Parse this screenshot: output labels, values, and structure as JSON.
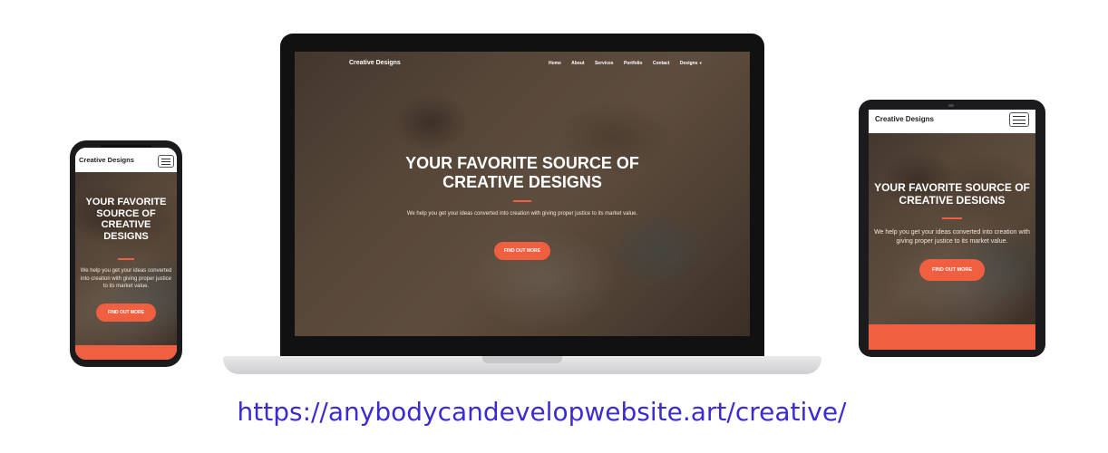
{
  "url": "https://anybodycandevelopwebsite.art/creative/",
  "brand": "Creative Designs",
  "nav": [
    "Home",
    "About",
    "Services",
    "Portfolio",
    "Contact",
    "Designs"
  ],
  "nav_dropdown_icon": "caret-down-icon",
  "hero": {
    "title": "YOUR FAVORITE SOURCE OF CREATIVE DESIGNS",
    "subtitle": "We help you get your ideas converted into creation with giving proper justice to its market value.",
    "cta": "FIND OUT MORE"
  },
  "colors": {
    "accent": "#f05f40",
    "url": "#3b2bd0"
  },
  "menu_icon": "hamburger-icon"
}
